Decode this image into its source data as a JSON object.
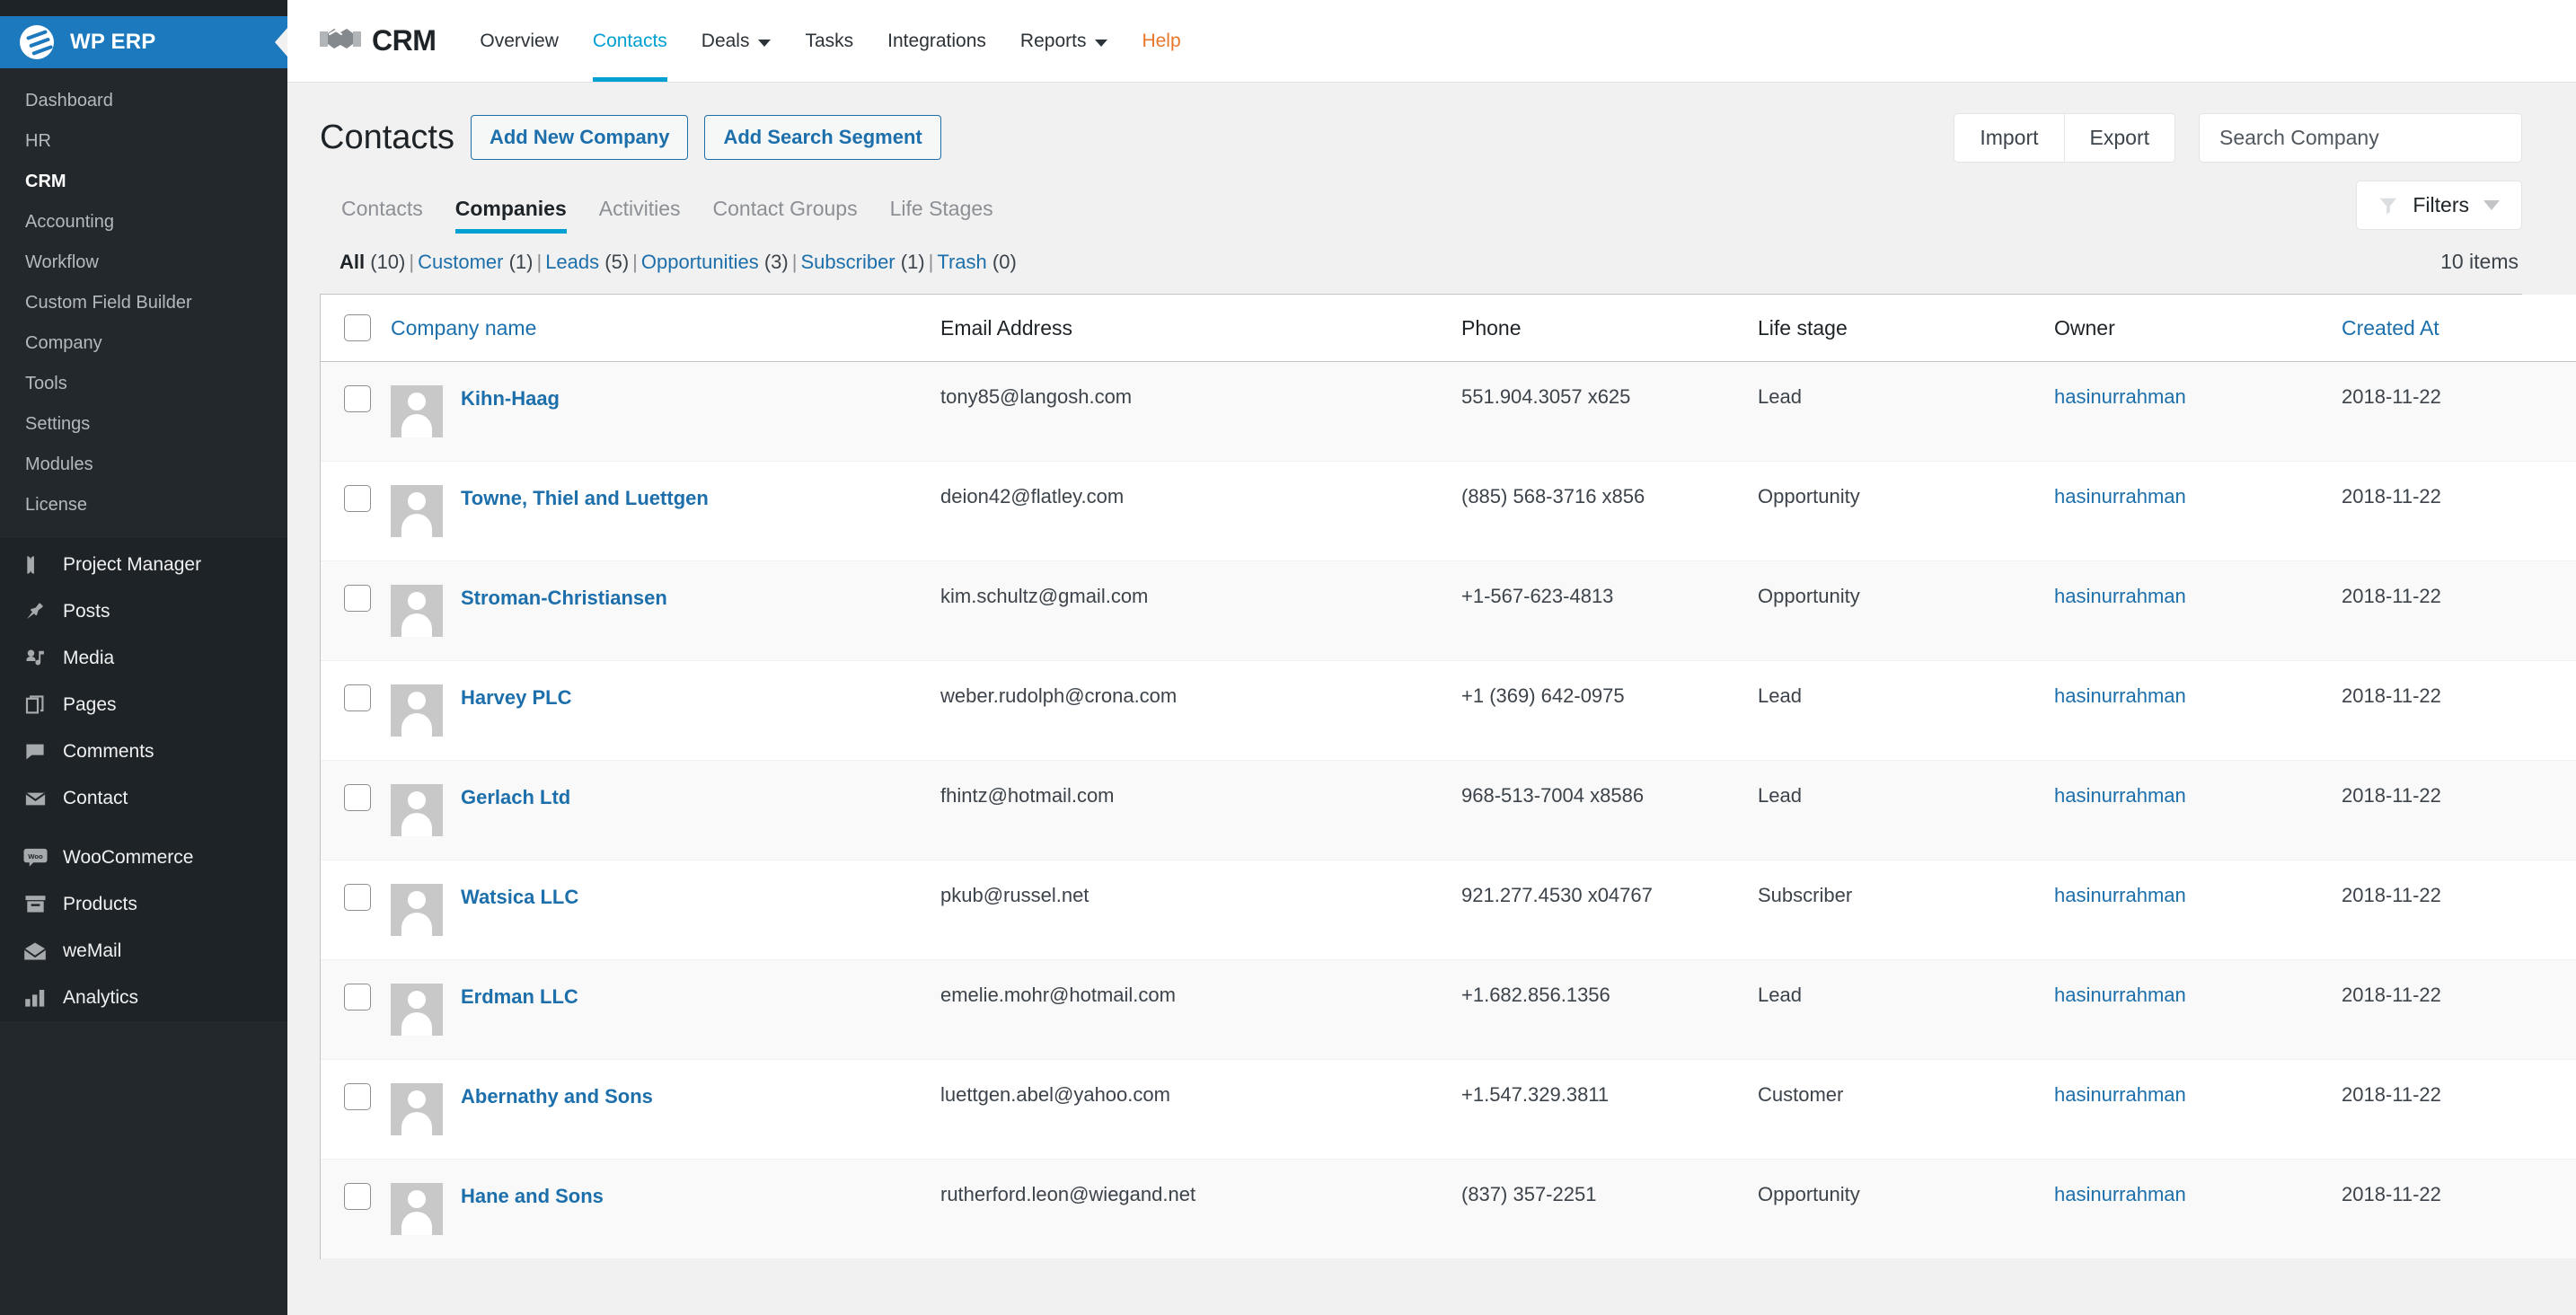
{
  "sidebar": {
    "brand": "WP ERP",
    "erp_items": [
      {
        "label": "Dashboard",
        "active": false
      },
      {
        "label": "HR",
        "active": false
      },
      {
        "label": "CRM",
        "active": true
      },
      {
        "label": "Accounting",
        "active": false
      },
      {
        "label": "Workflow",
        "active": false
      },
      {
        "label": "Custom Field Builder",
        "active": false
      },
      {
        "label": "Company",
        "active": false
      },
      {
        "label": "Tools",
        "active": false
      },
      {
        "label": "Settings",
        "active": false
      },
      {
        "label": "Modules",
        "active": false
      },
      {
        "label": "License",
        "active": false
      }
    ],
    "wp_items": [
      {
        "label": "Project Manager",
        "icon": "project-manager-icon"
      },
      {
        "label": "Posts",
        "icon": "pin-icon"
      },
      {
        "label": "Media",
        "icon": "media-icon"
      },
      {
        "label": "Pages",
        "icon": "pages-icon"
      },
      {
        "label": "Comments",
        "icon": "comment-icon"
      },
      {
        "label": "Contact",
        "icon": "envelope-icon"
      },
      {
        "label": "WooCommerce",
        "icon": "woo-icon"
      },
      {
        "label": "Products",
        "icon": "products-icon"
      },
      {
        "label": "weMail",
        "icon": "wemail-icon"
      },
      {
        "label": "Analytics",
        "icon": "bar-chart-icon"
      }
    ]
  },
  "crm_nav": {
    "brand": "CRM",
    "items": [
      {
        "label": "Overview",
        "active": false,
        "caret": false,
        "kind": "normal"
      },
      {
        "label": "Contacts",
        "active": true,
        "caret": false,
        "kind": "normal"
      },
      {
        "label": "Deals",
        "active": false,
        "caret": true,
        "kind": "normal"
      },
      {
        "label": "Tasks",
        "active": false,
        "caret": false,
        "kind": "normal"
      },
      {
        "label": "Integrations",
        "active": false,
        "caret": false,
        "kind": "normal"
      },
      {
        "label": "Reports",
        "active": false,
        "caret": true,
        "kind": "normal"
      },
      {
        "label": "Help",
        "active": false,
        "caret": false,
        "kind": "help"
      }
    ]
  },
  "page": {
    "title": "Contacts",
    "add_company_label": "Add New Company",
    "add_segment_label": "Add Search Segment",
    "import_label": "Import",
    "export_label": "Export",
    "search_placeholder": "Search Company",
    "search_value": "",
    "filters_label": "Filters",
    "items_count": "10 items"
  },
  "subtabs": [
    {
      "label": "Contacts",
      "active": false
    },
    {
      "label": "Companies",
      "active": true
    },
    {
      "label": "Activities",
      "active": false
    },
    {
      "label": "Contact Groups",
      "active": false
    },
    {
      "label": "Life Stages",
      "active": false
    }
  ],
  "statuses": [
    {
      "label": "All",
      "count": "(10)",
      "active": true
    },
    {
      "label": "Customer",
      "count": "(1)",
      "active": false
    },
    {
      "label": "Leads",
      "count": "(5)",
      "active": false
    },
    {
      "label": "Opportunities",
      "count": "(3)",
      "active": false
    },
    {
      "label": "Subscriber",
      "count": "(1)",
      "active": false
    },
    {
      "label": "Trash",
      "count": "(0)",
      "active": false
    }
  ],
  "table": {
    "columns": [
      {
        "key": "checkbox",
        "label": "",
        "sortable": false
      },
      {
        "key": "name",
        "label": "Company name",
        "sortable": true
      },
      {
        "key": "email",
        "label": "Email Address",
        "sortable": false
      },
      {
        "key": "phone",
        "label": "Phone",
        "sortable": false
      },
      {
        "key": "life_stage",
        "label": "Life stage",
        "sortable": false
      },
      {
        "key": "owner",
        "label": "Owner",
        "sortable": false
      },
      {
        "key": "created_at",
        "label": "Created At",
        "sortable": true
      }
    ],
    "rows": [
      {
        "name": "Kihn-Haag",
        "email": "tony85@langosh.com",
        "phone": "551.904.3057 x625",
        "life_stage": "Lead",
        "owner": "hasinurrahman",
        "created_at": "2018-11-22"
      },
      {
        "name": "Towne, Thiel and Luettgen",
        "email": "deion42@flatley.com",
        "phone": "(885) 568-3716 x856",
        "life_stage": "Opportunity",
        "owner": "hasinurrahman",
        "created_at": "2018-11-22"
      },
      {
        "name": "Stroman-Christiansen",
        "email": "kim.schultz@gmail.com",
        "phone": "+1-567-623-4813",
        "life_stage": "Opportunity",
        "owner": "hasinurrahman",
        "created_at": "2018-11-22"
      },
      {
        "name": "Harvey PLC",
        "email": "weber.rudolph@crona.com",
        "phone": "+1 (369) 642-0975",
        "life_stage": "Lead",
        "owner": "hasinurrahman",
        "created_at": "2018-11-22"
      },
      {
        "name": "Gerlach Ltd",
        "email": "fhintz@hotmail.com",
        "phone": "968-513-7004 x8586",
        "life_stage": "Lead",
        "owner": "hasinurrahman",
        "created_at": "2018-11-22"
      },
      {
        "name": "Watsica LLC",
        "email": "pkub@russel.net",
        "phone": "921.277.4530 x04767",
        "life_stage": "Subscriber",
        "owner": "hasinurrahman",
        "created_at": "2018-11-22"
      },
      {
        "name": "Erdman LLC",
        "email": "emelie.mohr@hotmail.com",
        "phone": "+1.682.856.1356",
        "life_stage": "Lead",
        "owner": "hasinurrahman",
        "created_at": "2018-11-22"
      },
      {
        "name": "Abernathy and Sons",
        "email": "luettgen.abel@yahoo.com",
        "phone": "+1.547.329.3811",
        "life_stage": "Customer",
        "owner": "hasinurrahman",
        "created_at": "2018-11-22"
      },
      {
        "name": "Hane and Sons",
        "email": "rutherford.leon@wiegand.net",
        "phone": "(837) 357-2251",
        "life_stage": "Opportunity",
        "owner": "hasinurrahman",
        "created_at": "2018-11-22"
      }
    ]
  },
  "colors": {
    "accent": "#00a0d2",
    "link": "#1c6fab",
    "brand_blue": "#1c79bd",
    "help_orange": "#e8762b",
    "sidebar_dark": "#1d2327",
    "sidebar_sub": "#23282d"
  }
}
